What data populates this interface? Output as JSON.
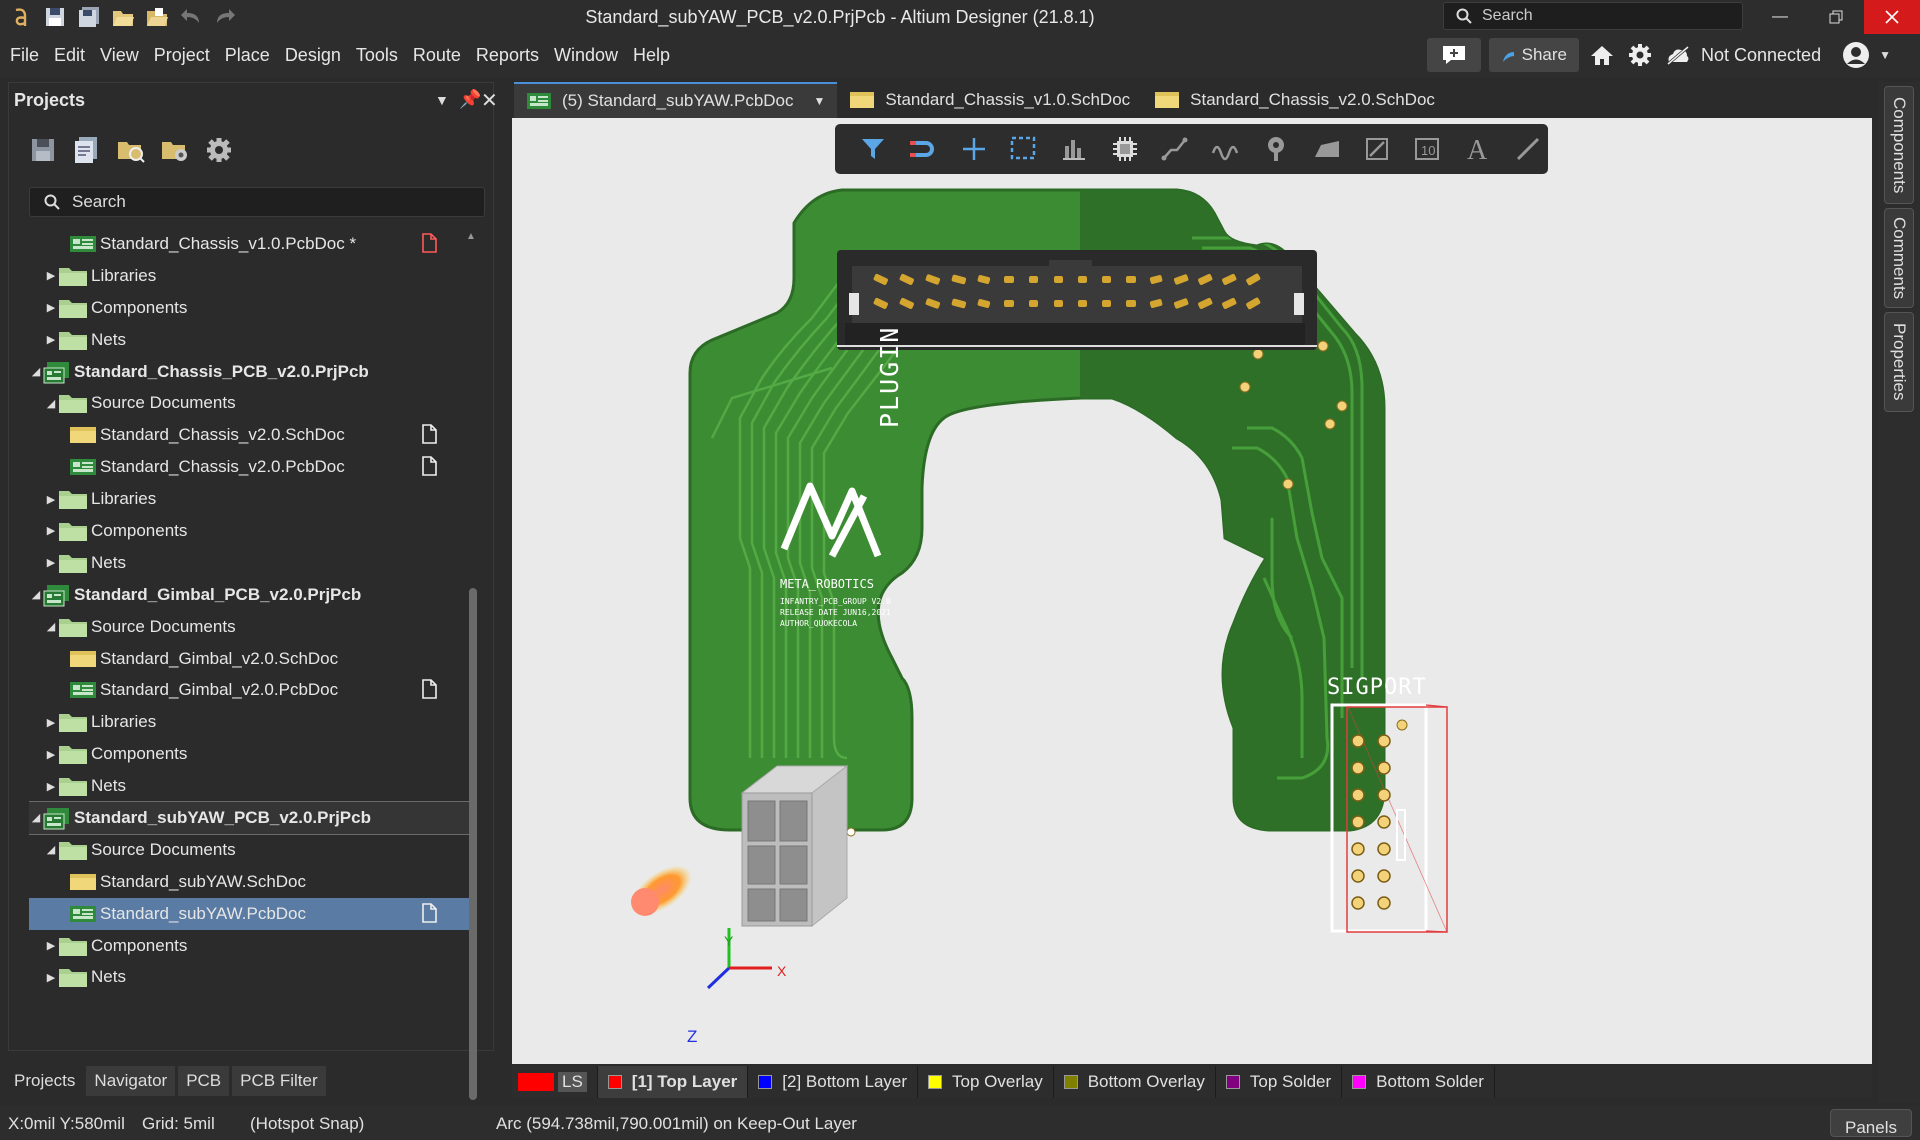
{
  "titlebar": {
    "title": "Standard_subYAW_PCB_v2.0.PrjPcb - Altium Designer (21.8.1)",
    "search_placeholder": "Search"
  },
  "menubar": {
    "items": [
      "File",
      "Edit",
      "View",
      "Project",
      "Place",
      "Design",
      "Tools",
      "Route",
      "Reports",
      "Window",
      "Help"
    ],
    "share_label": "Share",
    "connection_status": "Not Connected"
  },
  "projects_panel": {
    "title": "Projects",
    "search_placeholder": "Search",
    "tree": [
      {
        "label": "Standard_Chassis_v1.0.PcbDoc *",
        "icon": "pcbdoc-icon",
        "level": 2,
        "arrow": "",
        "flag": "modified-doc-icon"
      },
      {
        "label": "Libraries",
        "icon": "folder-icon",
        "level": 1,
        "arrow": "right"
      },
      {
        "label": "Components",
        "icon": "folder-icon",
        "level": 1,
        "arrow": "right"
      },
      {
        "label": "Nets",
        "icon": "folder-icon",
        "level": 1,
        "arrow": "right"
      },
      {
        "label": "Standard_Chassis_PCB_v2.0.PrjPcb",
        "icon": "project-icon",
        "level": 0,
        "arrow": "down",
        "bold": true
      },
      {
        "label": "Source Documents",
        "icon": "folder-icon",
        "level": 1,
        "arrow": "down"
      },
      {
        "label": "Standard_Chassis_v2.0.SchDoc",
        "icon": "schdoc-icon",
        "level": 2,
        "arrow": "",
        "flag": "doc-icon"
      },
      {
        "label": "Standard_Chassis_v2.0.PcbDoc",
        "icon": "pcbdoc-icon",
        "level": 2,
        "arrow": "",
        "flag": "doc-icon"
      },
      {
        "label": "Libraries",
        "icon": "folder-icon",
        "level": 1,
        "arrow": "right"
      },
      {
        "label": "Components",
        "icon": "folder-icon",
        "level": 1,
        "arrow": "right"
      },
      {
        "label": "Nets",
        "icon": "folder-icon",
        "level": 1,
        "arrow": "right"
      },
      {
        "label": "Standard_Gimbal_PCB_v2.0.PrjPcb",
        "icon": "project-icon",
        "level": 0,
        "arrow": "down",
        "bold": true
      },
      {
        "label": "Source Documents",
        "icon": "folder-icon",
        "level": 1,
        "arrow": "down"
      },
      {
        "label": "Standard_Gimbal_v2.0.SchDoc",
        "icon": "schdoc-icon",
        "level": 2,
        "arrow": ""
      },
      {
        "label": "Standard_Gimbal_v2.0.PcbDoc",
        "icon": "pcbdoc-icon",
        "level": 2,
        "arrow": "",
        "flag": "doc-icon"
      },
      {
        "label": "Libraries",
        "icon": "folder-icon",
        "level": 1,
        "arrow": "right"
      },
      {
        "label": "Components",
        "icon": "folder-icon",
        "level": 1,
        "arrow": "right"
      },
      {
        "label": "Nets",
        "icon": "folder-icon",
        "level": 1,
        "arrow": "right"
      },
      {
        "label": "Standard_subYAW_PCB_v2.0.PrjPcb",
        "icon": "project-icon",
        "level": 0,
        "arrow": "down",
        "bold": true,
        "outlined": true
      },
      {
        "label": "Source Documents",
        "icon": "folder-icon",
        "level": 1,
        "arrow": "down"
      },
      {
        "label": "Standard_subYAW.SchDoc",
        "icon": "schdoc-icon",
        "level": 2,
        "arrow": ""
      },
      {
        "label": "Standard_subYAW.PcbDoc",
        "icon": "pcbdoc-icon",
        "level": 2,
        "arrow": "",
        "flag": "doc-icon",
        "selected": true
      },
      {
        "label": "Components",
        "icon": "folder-icon",
        "level": 1,
        "arrow": "right"
      },
      {
        "label": "Nets",
        "icon": "folder-icon",
        "level": 1,
        "arrow": "right"
      }
    ]
  },
  "bottom_tabs": [
    "Projects",
    "Navigator",
    "PCB",
    "PCB Filter"
  ],
  "doc_tabs": [
    {
      "label": "(5) Standard_subYAW.PcbDoc",
      "icon": "pcbdoc-icon",
      "active": true
    },
    {
      "label": "Standard_Chassis_v1.0.SchDoc",
      "icon": "schdoc-icon"
    },
    {
      "label": "Standard_Chassis_v2.0.SchDoc",
      "icon": "schdoc-icon"
    }
  ],
  "right_panels": [
    "Components",
    "Comments",
    "Properties"
  ],
  "pcb": {
    "plugin_label": "PLUGIN",
    "sigport_label": "SIGPORT",
    "logo_text": "META_ROBOTICS",
    "logo_lines": [
      "INFANTRY_PCB_GROUP V2.0",
      "RELEASE DATE JUN16,2021",
      "AUTHOR_QUOKECOLA"
    ],
    "axis_x": "X",
    "axis_y": "Y",
    "axis_z": "Z",
    "board_color": "#3e8f34",
    "board_dark": "#2e6e2a"
  },
  "layers": [
    {
      "label": "LS",
      "color": "#ff0000",
      "kind": "ls"
    },
    {
      "label": "[1] Top Layer",
      "color": "#ff0000",
      "active": true
    },
    {
      "label": "[2] Bottom Layer",
      "color": "#0000ff"
    },
    {
      "label": "Top Overlay",
      "color": "#ffff00"
    },
    {
      "label": "Bottom Overlay",
      "color": "#808000"
    },
    {
      "label": "Top Solder",
      "color": "#800080"
    },
    {
      "label": "Bottom Solder",
      "color": "#ff00ff"
    }
  ],
  "status": {
    "coords": "X:0mil Y:580mil",
    "grid": "Grid: 5mil",
    "snap": "(Hotspot Snap)",
    "info": "Arc (594.738mil,790.001mil) on Keep-Out Layer",
    "panels_label": "Panels"
  }
}
